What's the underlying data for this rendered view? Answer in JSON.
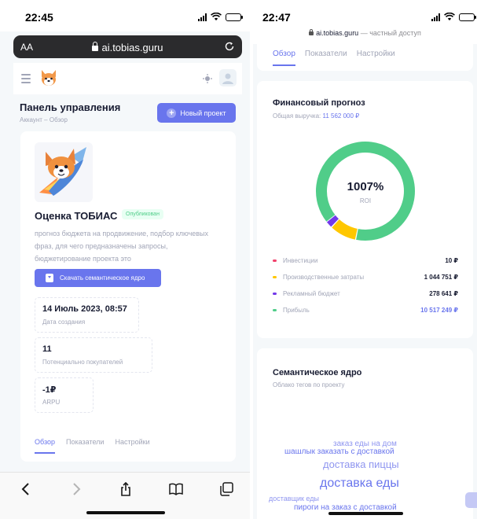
{
  "left": {
    "status_time": "22:45",
    "browser": {
      "aa": "AA",
      "url": "ai.tobias.guru"
    },
    "toolbar": {
      "title": "Панель управления",
      "breadcrumb": "Аккаунт – Обзор",
      "new_project": "Новый проект"
    },
    "project": {
      "title": "Оценка ТОБИАС",
      "badge": "Опубликован",
      "description": "прогноз бюджета на продвижение, подбор ключевых фраз, для чего предназначены запросы, бюджетирование проекта это",
      "download": "Скачать семантическое ядро"
    },
    "stats": [
      {
        "value": "14 Июль 2023, 08:57",
        "label": "Дата создания"
      },
      {
        "value": "11",
        "label": "Потенциально покупателей"
      },
      {
        "value": "-1₽",
        "label": "ARPU"
      }
    ],
    "tabs": [
      "Обзор",
      "Показатели",
      "Настройки"
    ]
  },
  "right": {
    "status_time": "22:47",
    "url": "ai.tobias.guru",
    "url_suffix": " — частный доступ",
    "tabs": [
      "Обзор",
      "Показатели",
      "Настройки"
    ],
    "finance": {
      "title": "Финансовый прогноз",
      "subtitle_label": "Общая выручка:",
      "subtitle_value": "11 562 000 ₽",
      "roi_value": "1007%",
      "roi_label": "ROI",
      "items": [
        {
          "name": "Инвестиции",
          "value": "10 ₽",
          "amount": 10,
          "color": "#f1416c"
        },
        {
          "name": "Производственные затраты",
          "value": "1 044 751 ₽",
          "amount": 1044751,
          "color": "#ffc700"
        },
        {
          "name": "Рекламный бюджет",
          "value": "278 641 ₽",
          "amount": 278641,
          "color": "#7239ea"
        },
        {
          "name": "Прибыль",
          "value": "10 517 249 ₽",
          "amount": 10517249,
          "color": "#50cd89"
        }
      ]
    },
    "semantic": {
      "title": "Семантическое ядро",
      "subtitle": "Облако тегов по проекту",
      "tags": [
        "заказ еды на дом",
        "шашлык заказать с доставкой",
        "доставка пиццы",
        "доставка еды",
        "доставщик еды",
        "пироги на заказ с доставкой"
      ]
    }
  },
  "colors": {
    "accent": "#6975ed",
    "success": "#50cd89",
    "muted": "#a1a5b7"
  }
}
